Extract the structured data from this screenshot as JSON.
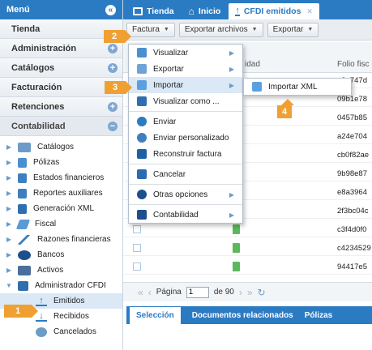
{
  "sidebar": {
    "title": "Menú",
    "sections": [
      {
        "label": "Tienda"
      },
      {
        "label": "Administración"
      },
      {
        "label": "Catálogos"
      },
      {
        "label": "Facturación"
      },
      {
        "label": "Retenciones"
      },
      {
        "label": "Contabilidad"
      }
    ],
    "tree": [
      {
        "label": "Catálogos",
        "icon": "folder-icon"
      },
      {
        "label": "Pólizas",
        "icon": "document-icon"
      },
      {
        "label": "Estados financieros",
        "icon": "report-icon"
      },
      {
        "label": "Reportes auxiliares",
        "icon": "report-icon"
      },
      {
        "label": "Generación XML",
        "icon": "xml-icon"
      },
      {
        "label": "Fiscal",
        "icon": "pencil-icon"
      },
      {
        "label": "Razones financieras",
        "icon": "chart-icon"
      },
      {
        "label": "Bancos",
        "icon": "bank-icon"
      },
      {
        "label": "Activos",
        "icon": "assets-icon"
      },
      {
        "label": "Administrador CFDI",
        "icon": "cfdi-icon"
      }
    ],
    "cfdi_children": [
      {
        "label": "Emitidos",
        "icon": "upload-icon"
      },
      {
        "label": "Recibidos",
        "icon": "download-icon"
      },
      {
        "label": "Cancelados",
        "icon": "cancel-icon"
      }
    ]
  },
  "tabs": [
    {
      "label": "Tienda",
      "icon": "store-icon"
    },
    {
      "label": "Inicio",
      "icon": "home-icon"
    },
    {
      "label": "CFDI emitidos",
      "icon": "upload-icon"
    }
  ],
  "toolbar": {
    "factura_label": "Factura",
    "exportar_archivos_label": "Exportar archivos",
    "exportar_label": "Exportar"
  },
  "grid": {
    "columns": [
      "idad",
      "Folio fisc"
    ],
    "folios": [
      "e3e747d",
      "09b1e78",
      "0457b85",
      "a24e704",
      "cb0f82ae",
      "9b98e87",
      "e8a3964",
      "2f3bc04c",
      "c3f4d0f0",
      "c4234529",
      "94417e5"
    ]
  },
  "pager": {
    "page_label": "Página",
    "page_value": "1",
    "of_label": "de 90"
  },
  "bottom_tabs": [
    "Selección",
    "Documentos relacionados",
    "Pólizas"
  ],
  "menu": {
    "items": [
      {
        "label": "Visualizar",
        "icon": "view-icon",
        "sub": true
      },
      {
        "label": "Exportar",
        "icon": "export-icon",
        "sub": true
      },
      {
        "label": "Importar",
        "icon": "import-icon",
        "sub": true
      },
      {
        "label": "Visualizar como ...",
        "icon": "view-as-icon",
        "sub": false
      },
      {
        "label": "Enviar",
        "icon": "send-icon",
        "sub": false
      },
      {
        "label": "Enviar personalizado",
        "icon": "send-custom-icon",
        "sub": false
      },
      {
        "label": "Reconstruir factura",
        "icon": "rebuild-icon",
        "sub": false
      },
      {
        "label": "Cancelar",
        "icon": "cancel-icon",
        "sub": false
      },
      {
        "label": "Otras opciones",
        "icon": "gear-icon",
        "sub": true
      },
      {
        "label": "Contabilidad",
        "icon": "accounting-icon",
        "sub": true
      }
    ],
    "submenu": {
      "label": "Importar XML",
      "icon": "xml-import-icon"
    }
  },
  "steps": [
    "1",
    "2",
    "3",
    "4"
  ],
  "colors": {
    "primary": "#2b7bc3",
    "step_badge": "#f0a033",
    "highlight": "#dbe8f5"
  }
}
